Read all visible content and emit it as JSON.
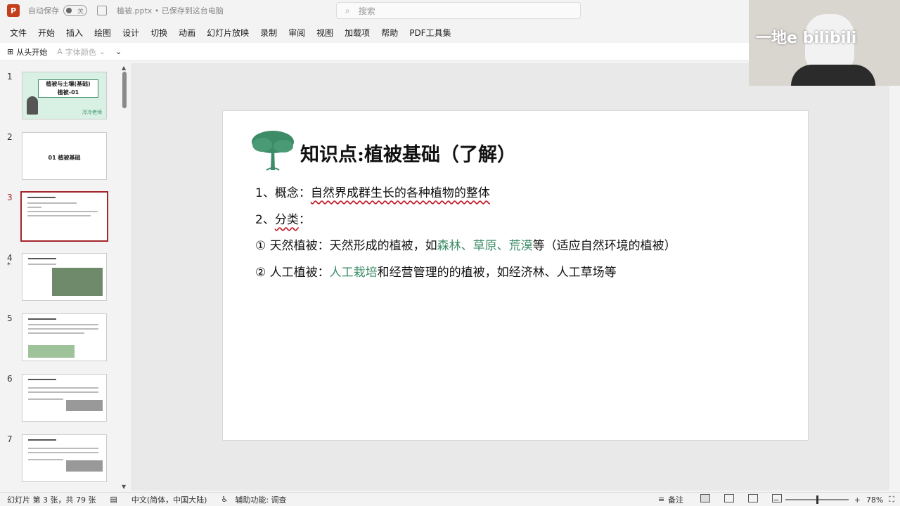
{
  "titlebar": {
    "autosave_label": "自动保存",
    "toggle_state": "关",
    "filename": "植被.pptx • 已保存到这台电脑",
    "search_placeholder": "搜索"
  },
  "menu": [
    "文件",
    "开始",
    "插入",
    "绘图",
    "设计",
    "切换",
    "动画",
    "幻灯片放映",
    "录制",
    "审阅",
    "视图",
    "加载项",
    "帮助",
    "PDF工具集"
  ],
  "quickbar": {
    "from_start": "从头开始",
    "font_color": "字体颜色"
  },
  "thumbnails": [
    {
      "num": "1",
      "title": "植被与土壤(基础)",
      "subtitle": "植被-01",
      "author": "冷冷老师"
    },
    {
      "num": "2",
      "title": "01 植被基础"
    },
    {
      "num": "3"
    },
    {
      "num": "4",
      "star": "*"
    },
    {
      "num": "5"
    },
    {
      "num": "6"
    },
    {
      "num": "7"
    }
  ],
  "slide": {
    "title": "知识点:植被基础（了解）",
    "line1": {
      "prefix": "1、概念：",
      "text": "自然界成群生长的各种植物的整体"
    },
    "line2": {
      "prefix": "2、",
      "text": "分类",
      "suffix": "："
    },
    "line3": {
      "a": "① 天然植被：天然形成的植被，如",
      "g1": "森林、草原、荒漠",
      "b": "等（适应自然环境的植被）"
    },
    "line4": {
      "a": "② 人工植被：",
      "g1": "人工栽培",
      "b": "和经营管理的的植被，如经济林、人工草场等"
    }
  },
  "webcam": {
    "overlay_text": "一地e bilibili"
  },
  "status": {
    "slide_info": "幻灯片 第 3 张，共 79 张",
    "language": "中文(简体，中国大陆)",
    "accessibility": "辅助功能: 调查",
    "notes": "备注",
    "zoom": "78%"
  },
  "colors": {
    "accent": "#a4262c",
    "green": "#3d8c68",
    "ppt": "#c43e1c"
  }
}
